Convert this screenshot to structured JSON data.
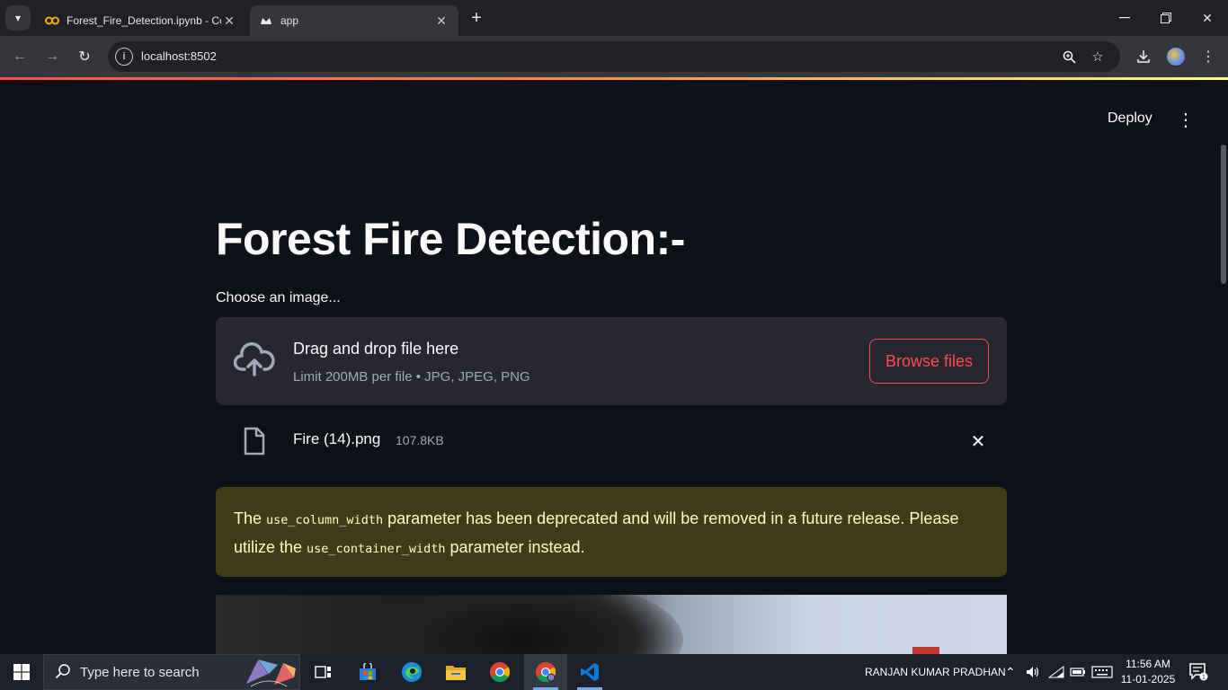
{
  "browser": {
    "tabs": [
      {
        "title": "Forest_Fire_Detection.ipynb - Co",
        "favicon": "colab-icon"
      },
      {
        "title": "app",
        "favicon": "streamlit-icon",
        "active": true
      }
    ],
    "url": "localhost:8502"
  },
  "app": {
    "deploy_label": "Deploy",
    "title": "Forest Fire Detection:-",
    "uploader": {
      "label": "Choose an image...",
      "drop_title": "Drag and drop file here",
      "drop_sub": "Limit 200MB per file • JPG, JPEG, PNG",
      "browse_label": "Browse files"
    },
    "file": {
      "name": "Fire (14).png",
      "size": "107.8KB"
    },
    "warning": {
      "t1": "The ",
      "code1": "use_column_width",
      "t2": " parameter has been deprecated and will be removed in a future release. Please utilize the ",
      "code2": "use_container_width",
      "t3": " parameter instead."
    }
  },
  "taskbar": {
    "search_placeholder": "Type here to search",
    "user": "RANJAN KUMAR PRADHAN",
    "time": "11:56 AM",
    "date": "11-01-2025",
    "notification_count": "1"
  },
  "colors": {
    "accent": "#ff4b4b",
    "warning_bg": "#3f3c18",
    "warning_text": "#ffffc2",
    "app_bg": "#0e1117"
  }
}
